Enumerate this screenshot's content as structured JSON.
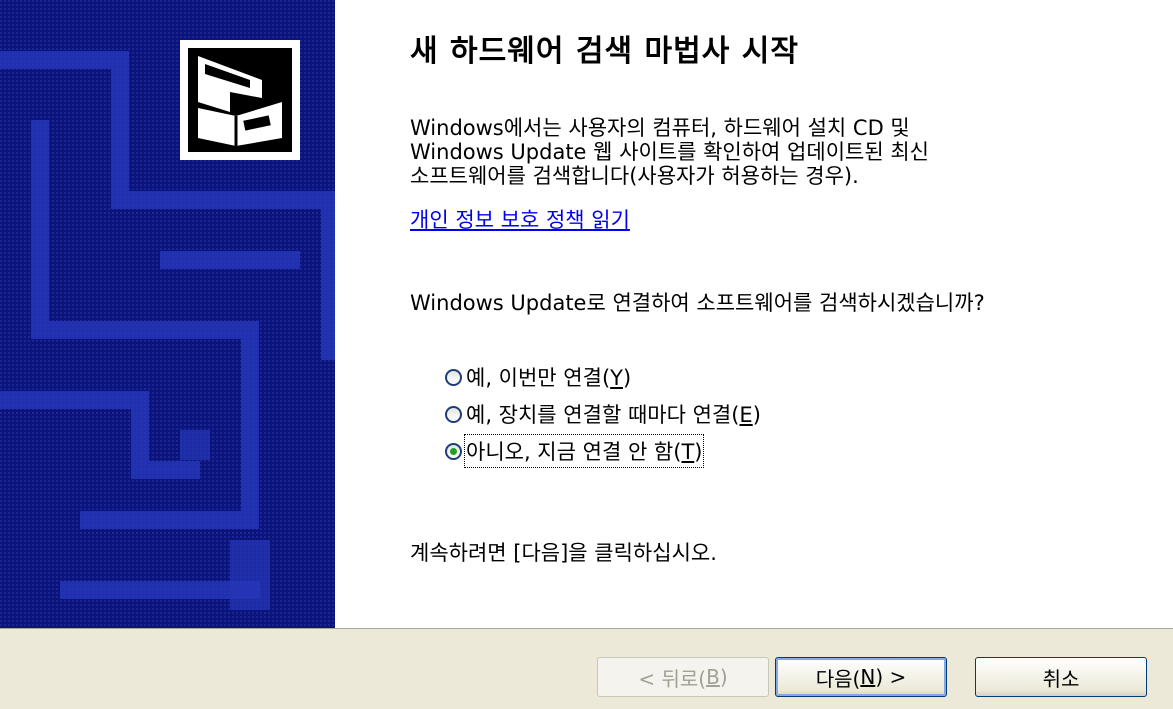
{
  "title": "새 하드웨어 검색 마법사 시작",
  "description_lines": [
    "Windows에서는 사용자의 컴퓨터, 하드웨어 설치 CD 및",
    "Windows Update 웹 사이트를 확인하여 업데이트된 최신",
    "소프트웨어를 검색합니다(사용자가 허용하는 경우)."
  ],
  "privacy_link": "개인 정보 보호 정책 읽기",
  "question": "Windows Update로 연결하여 소프트웨어를 검색하시겠습니까?",
  "options": [
    {
      "pre": "예, 이번만 연결(",
      "key": "Y",
      "post": ")",
      "checked": false
    },
    {
      "pre": "예, 장치를 연결할 때마다 연결(",
      "key": "E",
      "post": ")",
      "checked": false
    },
    {
      "pre": "아니오, 지금 연결 안 함(",
      "key": "T",
      "post": ")",
      "checked": true
    }
  ],
  "continue_text": "계속하려면 [다음]을 클릭하십시오.",
  "buttons": {
    "back": {
      "pre": "< 뒤로(",
      "key": "B",
      "post": ")",
      "enabled": false
    },
    "next": {
      "pre": "다음(",
      "key": "N",
      "post": ") >",
      "enabled": true
    },
    "cancel": {
      "label": "취소"
    }
  },
  "icons": {
    "hardware": "hardware-card-icon"
  },
  "colors": {
    "side_panel": "#0b147a",
    "footer": "#ece9d8",
    "link": "#0000ee",
    "radio_dot": "#21a121"
  }
}
